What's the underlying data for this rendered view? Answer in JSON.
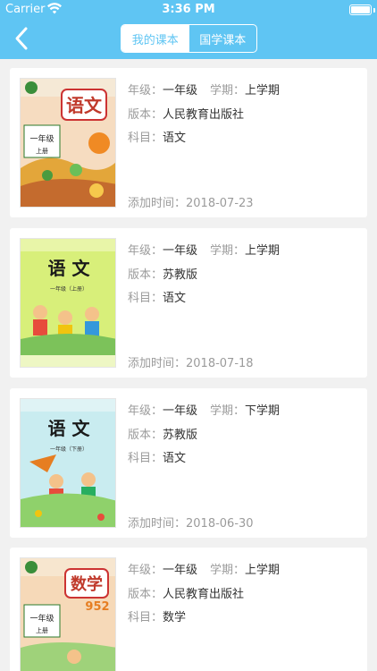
{
  "status_bar": {
    "carrier": "Carrier",
    "time": "3:36 PM"
  },
  "nav": {
    "back_icon": "chevron-left-icon",
    "tabs": [
      {
        "label": "我的课本",
        "active": true
      },
      {
        "label": "国学课本",
        "active": false
      }
    ]
  },
  "labels": {
    "grade": "年级：",
    "term": "学期：",
    "edition": "版本：",
    "subject": "科目：",
    "added": "添加时间："
  },
  "books": [
    {
      "grade": "一年级",
      "term": "上学期",
      "edition": "人民教育出版社",
      "subject": "语文",
      "added": "2018-07-23",
      "cover_title": "语文",
      "cover_grade": "一年级",
      "cover_volume": "上册"
    },
    {
      "grade": "一年级",
      "term": "上学期",
      "edition": "苏教版",
      "subject": "语文",
      "added": "2018-07-18",
      "cover_title": "语 文",
      "cover_grade": "一年级（上册）"
    },
    {
      "grade": "一年级",
      "term": "下学期",
      "edition": "苏教版",
      "subject": "语文",
      "added": "2018-06-30",
      "cover_title": "语 文",
      "cover_grade": "一年级（下册）"
    },
    {
      "grade": "一年级",
      "term": "上学期",
      "edition": "人民教育出版社",
      "subject": "数学",
      "added": "",
      "cover_title": "数学",
      "cover_grade": "一年级",
      "cover_volume": "上册",
      "cover_digits": "952"
    }
  ],
  "colors": {
    "header": "#5fc5f3",
    "label": "#9b9b9b",
    "value": "#333333"
  }
}
